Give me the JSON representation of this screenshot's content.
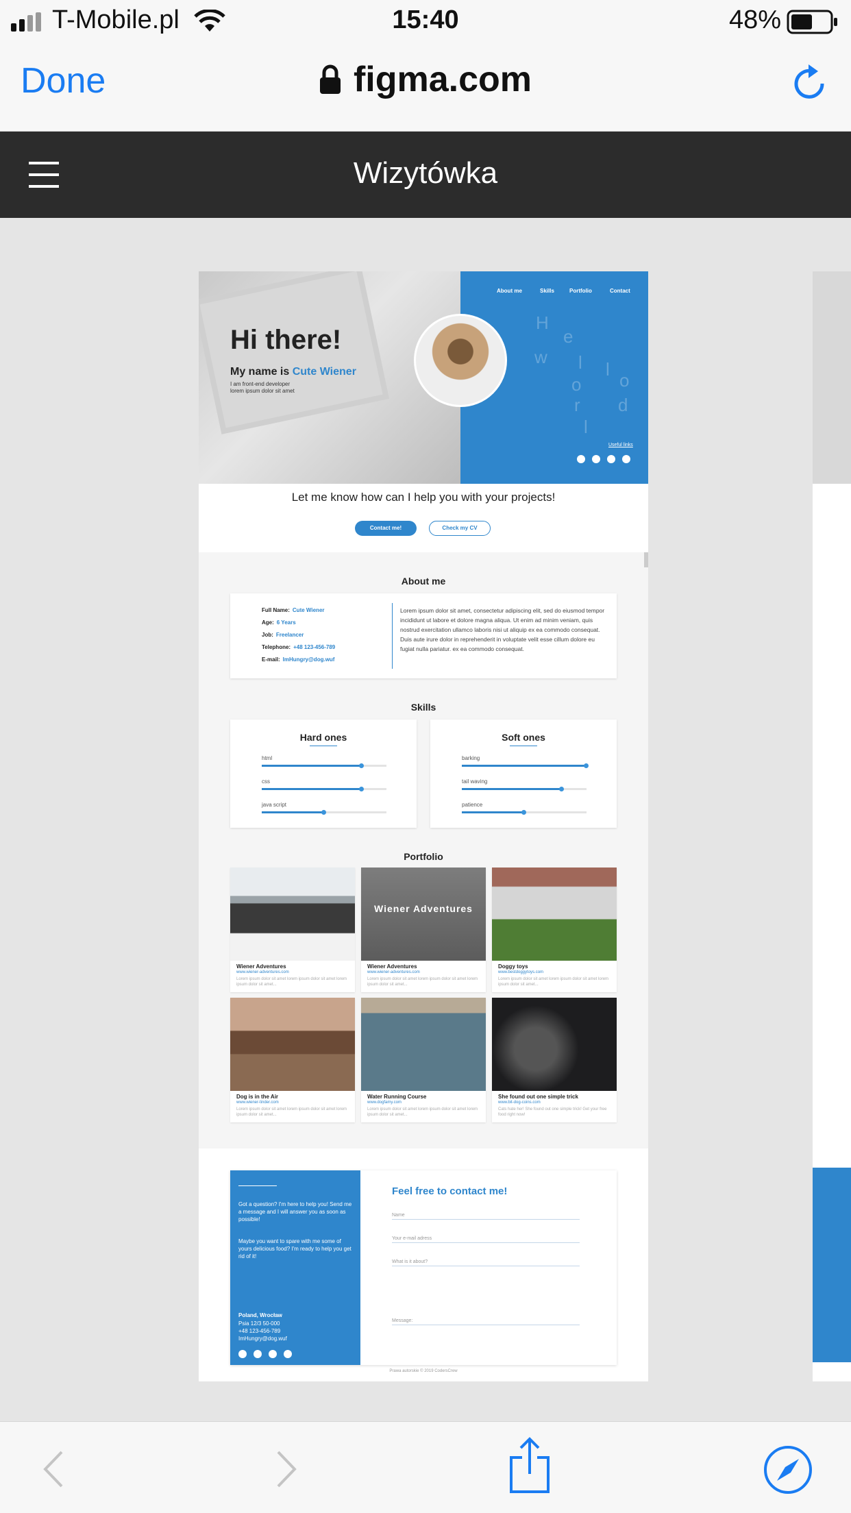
{
  "status_bar": {
    "carrier": "T-Mobile.pl",
    "time": "15:40",
    "battery": "48%"
  },
  "browser": {
    "done_label": "Done",
    "url": "figma.com"
  },
  "figma": {
    "file_title": "Wizytówka"
  },
  "design": {
    "hero": {
      "nav": [
        "About me",
        "Skills",
        "Portfolio",
        "Contact"
      ],
      "greeting": "Hi there!",
      "name_prefix": "My name is",
      "name": "Cute Wiener",
      "line1": "I am front-end developer",
      "line2": "lorem ipsum dolor sit amet",
      "hello_letters": [
        "H",
        "e",
        "l",
        "l",
        "o",
        "w",
        "o",
        "r",
        "l",
        "d"
      ],
      "useful_links": "Useful links"
    },
    "cta": {
      "text": "Let me know how can I help you with your projects!",
      "contact_button": "Contact me!",
      "cv_button": "Check my CV"
    },
    "about": {
      "title": "About me",
      "rows": [
        {
          "label": "Full Name:",
          "value": "Cute Wiener"
        },
        {
          "label": "Age:",
          "value": "6 Years"
        },
        {
          "label": "Job:",
          "value": "Freelancer"
        },
        {
          "label": "Telephone:",
          "value": "+48 123-456-789"
        },
        {
          "label": "E-mail:",
          "value": "ImHungry@dog.wuf"
        }
      ],
      "text": "Lorem ipsum dolor sit amet, consectetur adipiscing elit, sed do eiusmod tempor incididunt ut labore et dolore magna aliqua. Ut enim ad minim veniam, quis nostrud exercitation ullamco laboris nisi ut aliquip ex ea commodo consequat. Duis aute irure dolor in reprehenderit in voluptate velit esse cillum dolore eu fugiat nulla pariatur. ex ea commodo consequat."
    },
    "skills": {
      "title": "Skills",
      "hard": {
        "title": "Hard ones",
        "items": [
          {
            "label": "html",
            "level": 0.8
          },
          {
            "label": "css",
            "level": 0.8
          },
          {
            "label": "java script",
            "level": 0.5
          }
        ]
      },
      "soft": {
        "title": "Soft ones",
        "items": [
          {
            "label": "barking",
            "level": 1.0
          },
          {
            "label": "tail waving",
            "level": 0.8
          },
          {
            "label": "patience",
            "level": 0.5
          }
        ]
      }
    },
    "portfolio": {
      "title": "Portfolio",
      "overlay_text": "Wiener Adventures",
      "items": [
        {
          "title": "Wiener Adventures",
          "link": "www.wiener-adventures.com",
          "desc": "Lorem ipsum dolor sit amet lorem ipsum dolor sit amet lorem ipsum dolor sit amet..."
        },
        {
          "title": "Wiener Adventures",
          "link": "www.wiener-adventures.com",
          "desc": "Lorem ipsum dolor sit amet lorem ipsum dolor sit amet lorem ipsum dolor sit amet..."
        },
        {
          "title": "Doggy toys",
          "link": "www.bestdoggytoys.com",
          "desc": "Lorem ipsum dolor sit amet lorem ipsum dolor sit amet lorem ipsum dolor sit amet..."
        },
        {
          "title": "Dog is in the Air",
          "link": "www.wiener-tinder.com",
          "desc": "Lorem ipsum dolor sit amet lorem ipsum dolor sit amet lorem ipsum dolor sit amet..."
        },
        {
          "title": "Water Running Course",
          "link": "www.dogfamy.com",
          "desc": "Lorem ipsum dolor sit amet lorem ipsum dolor sit amet lorem ipsum dolor sit amet..."
        },
        {
          "title": "She found out one simple trick",
          "link": "www.bit-dog-coins.com",
          "desc": "Cats hate her! She found out one simple trick! Get your free food right now!"
        }
      ]
    },
    "contact": {
      "left_p1": "Got a question? I'm here to help you! Send me a message and I will answer you as soon as possible!",
      "left_p2": "Maybe you want to spare with me some of yours delicious food? I'm ready to help you get rid of it!",
      "address_title": "Poland, Wrocław",
      "address_street": "Psia 12/3 50-000",
      "address_phone": "+48 123-456-789",
      "address_email": "ImHungry@dog.wuf",
      "form_title": "Feel free to contact me!",
      "fields": [
        "Name",
        "Your e-mail adress",
        "What is it about?",
        "Message:"
      ]
    },
    "footer": "Prawa autorskie © 2019 CodersCrew"
  },
  "colors": {
    "accent": "#2f86cc",
    "safari_blue": "#1a7cf2",
    "figma_header": "#2c2c2c"
  }
}
